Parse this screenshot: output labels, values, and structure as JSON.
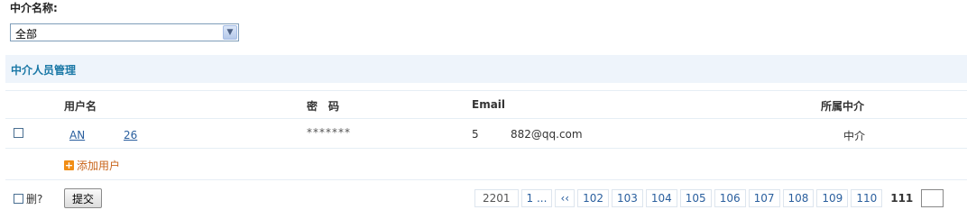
{
  "filter": {
    "label": "中介名称:",
    "selected": "全部",
    "arrow": "▼"
  },
  "section": {
    "title": "中介人员管理"
  },
  "columns": {
    "username": "用户名",
    "password": "密　码",
    "email": "Email",
    "agency": "所属中介"
  },
  "row": {
    "username_a": "AN",
    "username_b": "26",
    "password": "*******",
    "email_a": "5",
    "email_b": "882@qq.com",
    "agency": "中介"
  },
  "add_user": {
    "icon": "+",
    "label": "添加用户"
  },
  "footer": {
    "delete_label": "删?",
    "submit_label": "提交"
  },
  "pagination": {
    "total": "2201",
    "first": "1 ...",
    "prev": "‹‹",
    "pages": [
      "102",
      "103",
      "104",
      "105",
      "106",
      "107",
      "108",
      "109",
      "110"
    ],
    "current": "111"
  },
  "colors": {
    "section_bg": "#eef4fb",
    "section_title": "#1a78a6",
    "link": "#2a5f9e",
    "add_user": "#c9651b"
  }
}
